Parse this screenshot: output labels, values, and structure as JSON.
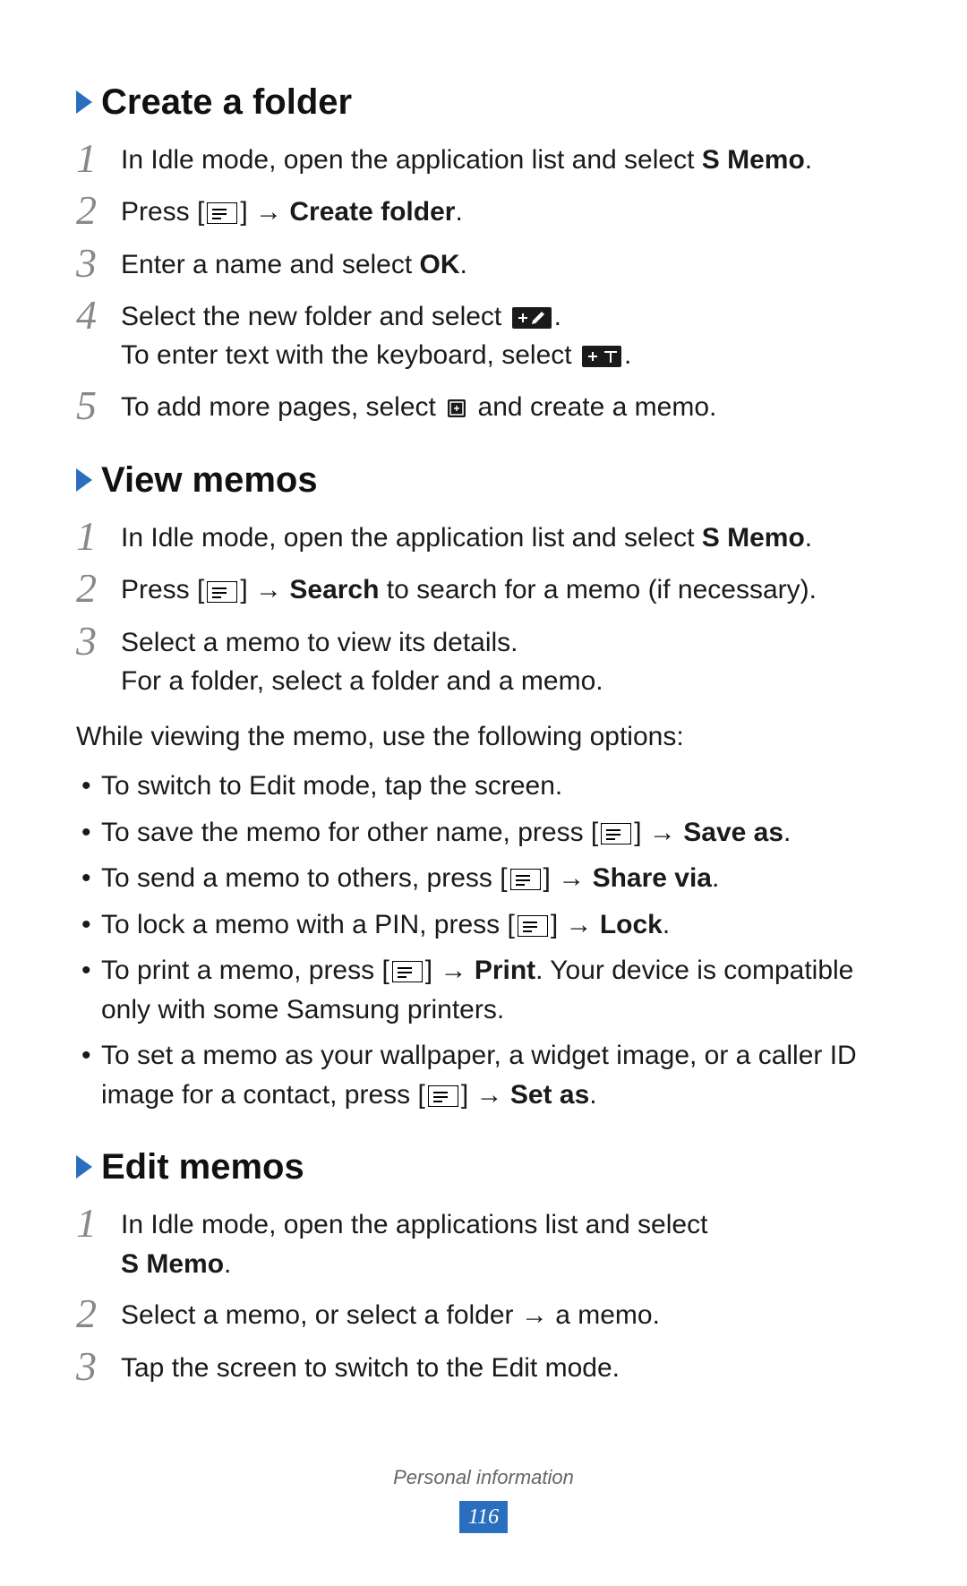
{
  "sections": {
    "createFolder": {
      "title": "Create a folder",
      "steps": {
        "s1": {
          "num": "1",
          "pre": "In Idle mode, open the application list and select ",
          "bold": "S Memo",
          "post": "."
        },
        "s2": {
          "num": "2",
          "pre": "Press [",
          "mid": "] → ",
          "bold": "Create folder",
          "post": "."
        },
        "s3": {
          "num": "3",
          "pre": "Enter a name and select ",
          "bold": "OK",
          "post": "."
        },
        "s4": {
          "num": "4",
          "line1a": "Select the new folder and select ",
          "line1b": ".",
          "line2a": "To enter text with the keyboard, select ",
          "line2b": "."
        },
        "s5": {
          "num": "5",
          "pre": "To add more pages, select ",
          "post": " and create a memo."
        }
      }
    },
    "viewMemos": {
      "title": "View memos",
      "steps": {
        "s1": {
          "num": "1",
          "pre": "In Idle mode, open the application list and select ",
          "bold": "S Memo",
          "post": "."
        },
        "s2": {
          "num": "2",
          "pre": "Press [",
          "mid": "] → ",
          "bold": "Search",
          "post": " to search for a memo (if necessary)."
        },
        "s3": {
          "num": "3",
          "line1": "Select a memo to view its details.",
          "line2": "For a folder, select a folder and a memo."
        }
      },
      "intro": "While viewing the memo, use the following options:",
      "bullets": {
        "b1": "To switch to Edit mode, tap the screen.",
        "b2": {
          "pre": "To save the memo for other name, press [",
          "mid": "] → ",
          "bold": "Save as",
          "post": "."
        },
        "b3": {
          "pre": "To send a memo to others, press [",
          "mid": "] → ",
          "bold": "Share via",
          "post": "."
        },
        "b4": {
          "pre": "To lock a memo with a PIN, press [",
          "mid": "] → ",
          "bold": "Lock",
          "post": "."
        },
        "b5": {
          "pre": "To print a memo, press [",
          "mid": "] → ",
          "bold": "Print",
          "post": ". Your device is compatible only with some Samsung printers."
        },
        "b6": {
          "pre": "To set a memo as your wallpaper, a widget image, or a caller ID image for a contact, press [",
          "mid": "] → ",
          "bold": "Set as",
          "post": "."
        }
      }
    },
    "editMemos": {
      "title": "Edit memos",
      "steps": {
        "s1": {
          "num": "1",
          "line1": "In Idle mode, open the applications list and select",
          "bold": "S Memo",
          "post": "."
        },
        "s2": {
          "num": "2",
          "text": "Select a memo, or select a folder → a memo."
        },
        "s3": {
          "num": "3",
          "text": "Tap the screen to switch to the Edit mode."
        }
      }
    }
  },
  "footer": {
    "section": "Personal information",
    "page": "116"
  }
}
